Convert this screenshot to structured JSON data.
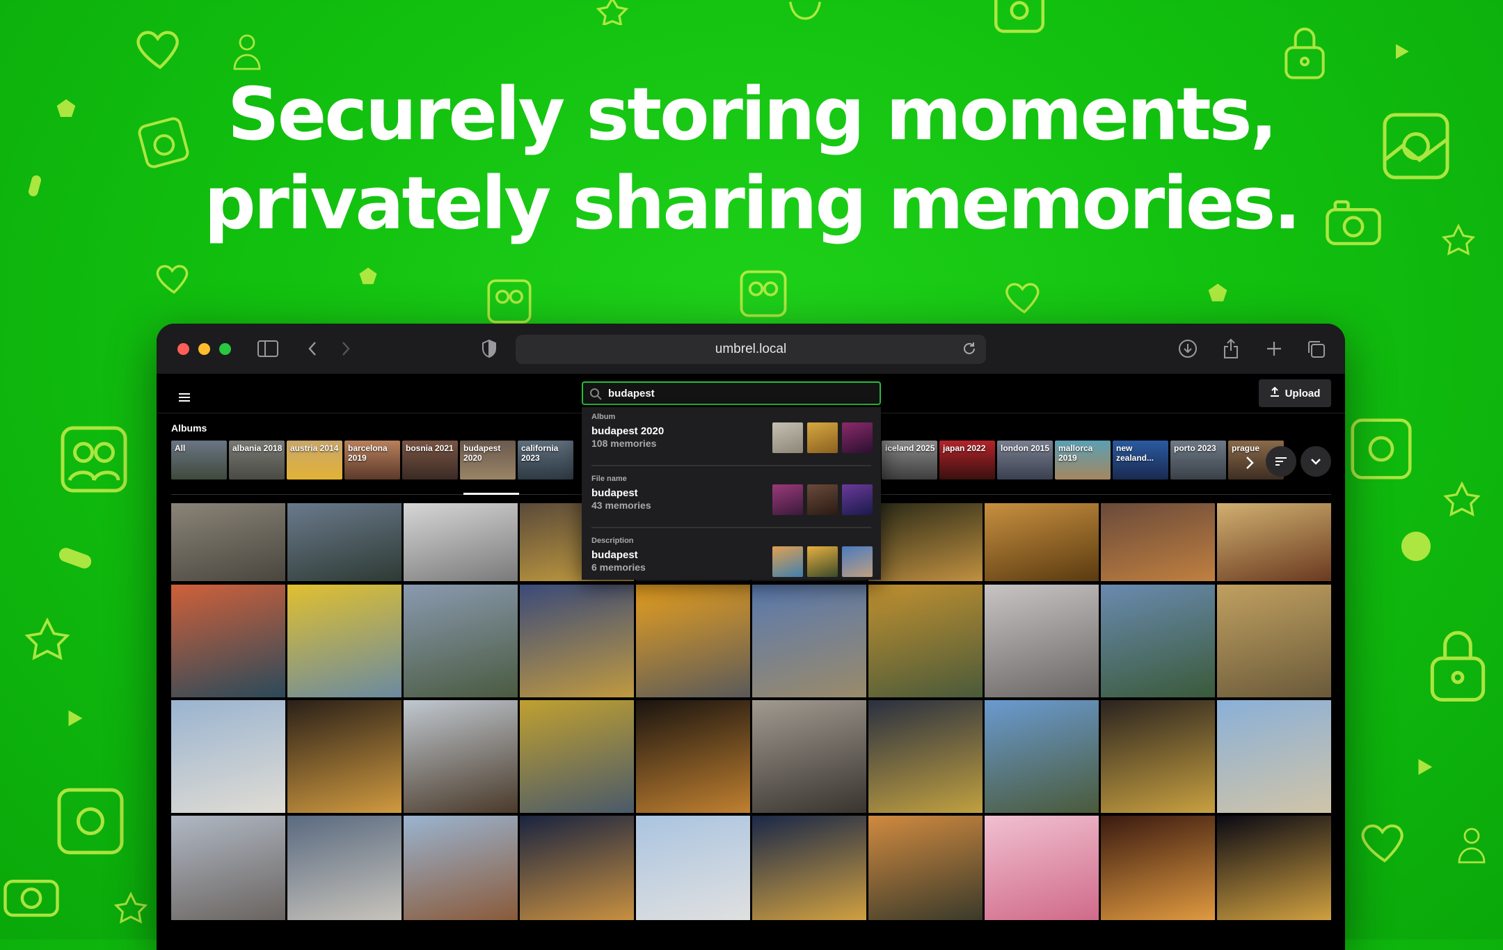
{
  "headline": {
    "line1": "Securely storing moments,",
    "line2": "privately sharing memories."
  },
  "colors": {
    "background": "#14c414",
    "decoration": "#c8ef4a",
    "search_border": "#26c03a",
    "browser_toolbar": "#1c1c1e"
  },
  "browser": {
    "url": "umbrel.local",
    "toolbar_icons": [
      "sidebar-icon",
      "back-icon",
      "forward-icon",
      "shield-icon",
      "download-icon",
      "share-icon",
      "new-tab-icon",
      "tabs-overview-icon"
    ]
  },
  "app": {
    "search": {
      "value": "budapest"
    },
    "upload_label": "Upload",
    "albums_label": "Albums",
    "albums": [
      {
        "label": "All",
        "colors": [
          "#6a7584",
          "#3f4a3c"
        ]
      },
      {
        "label": "albania 2018",
        "colors": [
          "#7a7a74",
          "#4a4a44"
        ]
      },
      {
        "label": "austria 2014",
        "colors": [
          "#c9a66b",
          "#e2b236"
        ]
      },
      {
        "label": "barcelona 2019",
        "colors": [
          "#b9805c",
          "#5b3a2a"
        ]
      },
      {
        "label": "bosnia 2021",
        "colors": [
          "#7a5544",
          "#3a2a24"
        ]
      },
      {
        "label": "budapest 2020",
        "colors": [
          "#6a5a4e",
          "#9a8466"
        ]
      },
      {
        "label": "california 2023",
        "colors": [
          "#5e6e7c",
          "#2e3a44"
        ]
      },
      {
        "label": "iceland 2025",
        "colors": [
          "#8a8a8a",
          "#3e3e3e"
        ]
      },
      {
        "label": "japan 2022",
        "colors": [
          "#b4232a",
          "#3a1010"
        ]
      },
      {
        "label": "london 2015",
        "colors": [
          "#7a7f90",
          "#3a4050"
        ]
      },
      {
        "label": "mallorca 2019",
        "colors": [
          "#5aa0b4",
          "#a58660"
        ]
      },
      {
        "label": "new zealand...",
        "colors": [
          "#2a5aa0",
          "#1a2a50"
        ]
      },
      {
        "label": "porto 2023",
        "colors": [
          "#6e7a86",
          "#3a4048"
        ]
      },
      {
        "label": "prague",
        "colors": [
          "#8a6a4a",
          "#3e2e22"
        ]
      }
    ],
    "search_dropdown": [
      {
        "header": "Album",
        "title": "budapest 2020",
        "count": "108 memories",
        "thumbs": [
          [
            "#c5c0b2",
            "#8b8676"
          ],
          [
            "#d8a840",
            "#8a6020"
          ],
          [
            "#8a2a6a",
            "#2a1030"
          ]
        ]
      },
      {
        "header": "File name",
        "title": "budapest",
        "count": "43 memories",
        "thumbs": [
          [
            "#9a3a7a",
            "#3a1a3a"
          ],
          [
            "#6a4a3a",
            "#2a1a14"
          ],
          [
            "#6a3a9a",
            "#1a1a4a"
          ]
        ]
      },
      {
        "header": "Description",
        "title": "budapest",
        "count": "6 memories",
        "thumbs": [
          [
            "#e0a050",
            "#4080b0"
          ],
          [
            "#e8b040",
            "#3a4a2a"
          ],
          [
            "#4a7ac0",
            "#c0a080"
          ]
        ]
      }
    ],
    "photos": [
      [
        "#8a8478",
        "#4a463e"
      ],
      [
        "#6a7a8c",
        "#2e3a34"
      ],
      [
        "#d6d6d6",
        "#7a7a7a"
      ],
      [
        "#5a4a3a",
        "#c8a040"
      ],
      [
        "#3a3040",
        "#1a1820"
      ],
      [
        "#3a3a3a",
        "#1a1a1a"
      ],
      [
        "#2a2a18",
        "#c09040"
      ],
      [
        "#c89040",
        "#5a3a10"
      ],
      [
        "#6a4a3a",
        "#c08040"
      ],
      [
        "#d0b070",
        "#6a3a20"
      ],
      [
        "#d0603a",
        "#2a4a5a"
      ],
      [
        "#e0c030",
        "#6a8aa0"
      ],
      [
        "#8a9ab0",
        "#4a5a40"
      ],
      [
        "#3a4a7a",
        "#c09a40"
      ],
      [
        "#e8a020",
        "#5a5a5a"
      ],
      [
        "#5a7ab0",
        "#9a8a6a"
      ],
      [
        "#c09030",
        "#4a5a3a"
      ],
      [
        "#c8c4c4",
        "#6a6664"
      ],
      [
        "#6a8ab0",
        "#3a5a3a"
      ],
      [
        "#c0a060",
        "#6a5a3a"
      ],
      [
        "#9ab4d0",
        "#e0dcd4"
      ],
      [
        "#2a2018",
        "#d09a40"
      ],
      [
        "#c0c8d0",
        "#4a3a2a"
      ],
      [
        "#c0a030",
        "#4a5a6a"
      ],
      [
        "#1a1410",
        "#c08030"
      ],
      [
        "#a09a90",
        "#3a3430"
      ],
      [
        "#2a3040",
        "#c0a040"
      ],
      [
        "#6a9ad0",
        "#4a5a3a"
      ],
      [
        "#2a2420",
        "#c8a040"
      ],
      [
        "#8ab0d8",
        "#d0c4a8"
      ],
      [
        "#b0b8c4",
        "#6a6460"
      ],
      [
        "#5a6a80",
        "#c8c4bc"
      ],
      [
        "#9ab4d0",
        "#8a5a3a"
      ],
      [
        "#1a2440",
        "#c89040"
      ],
      [
        "#aac4e0",
        "#e0e0e0"
      ],
      [
        "#1a2848",
        "#d0a040"
      ],
      [
        "#d08a40",
        "#3a3a2a"
      ],
      [
        "#f0c0d0",
        "#d06a8a"
      ],
      [
        "#3a1a10",
        "#e09a40"
      ],
      [
        "#0a0a14",
        "#d0a040"
      ]
    ]
  }
}
